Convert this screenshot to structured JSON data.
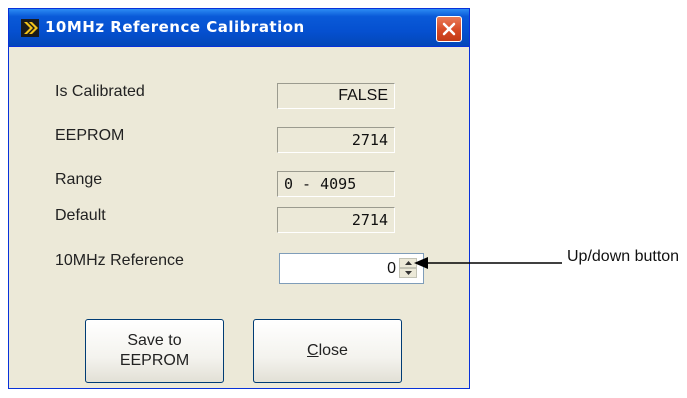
{
  "window": {
    "title": "10MHz Reference Calibration",
    "title_color": "#ffffff",
    "titlebar_color": "#0a5ad8",
    "close_icon": "close-icon",
    "app_icon": "arrow-app-icon"
  },
  "fields": {
    "is_calibrated": {
      "label": "Is Calibrated",
      "value": "FALSE"
    },
    "eeprom": {
      "label": "EEPROM",
      "value": "2714"
    },
    "range": {
      "label": "Range",
      "value": "0 - 4095"
    },
    "default": {
      "label": "Default",
      "value": "2714"
    },
    "reference": {
      "label": "10MHz Reference",
      "value": "0"
    }
  },
  "buttons": {
    "save_line1": "Save to",
    "save_line2": "EEPROM",
    "close_accel": "C",
    "close_rest": "lose"
  },
  "annotation": {
    "label": "Up/down button"
  }
}
